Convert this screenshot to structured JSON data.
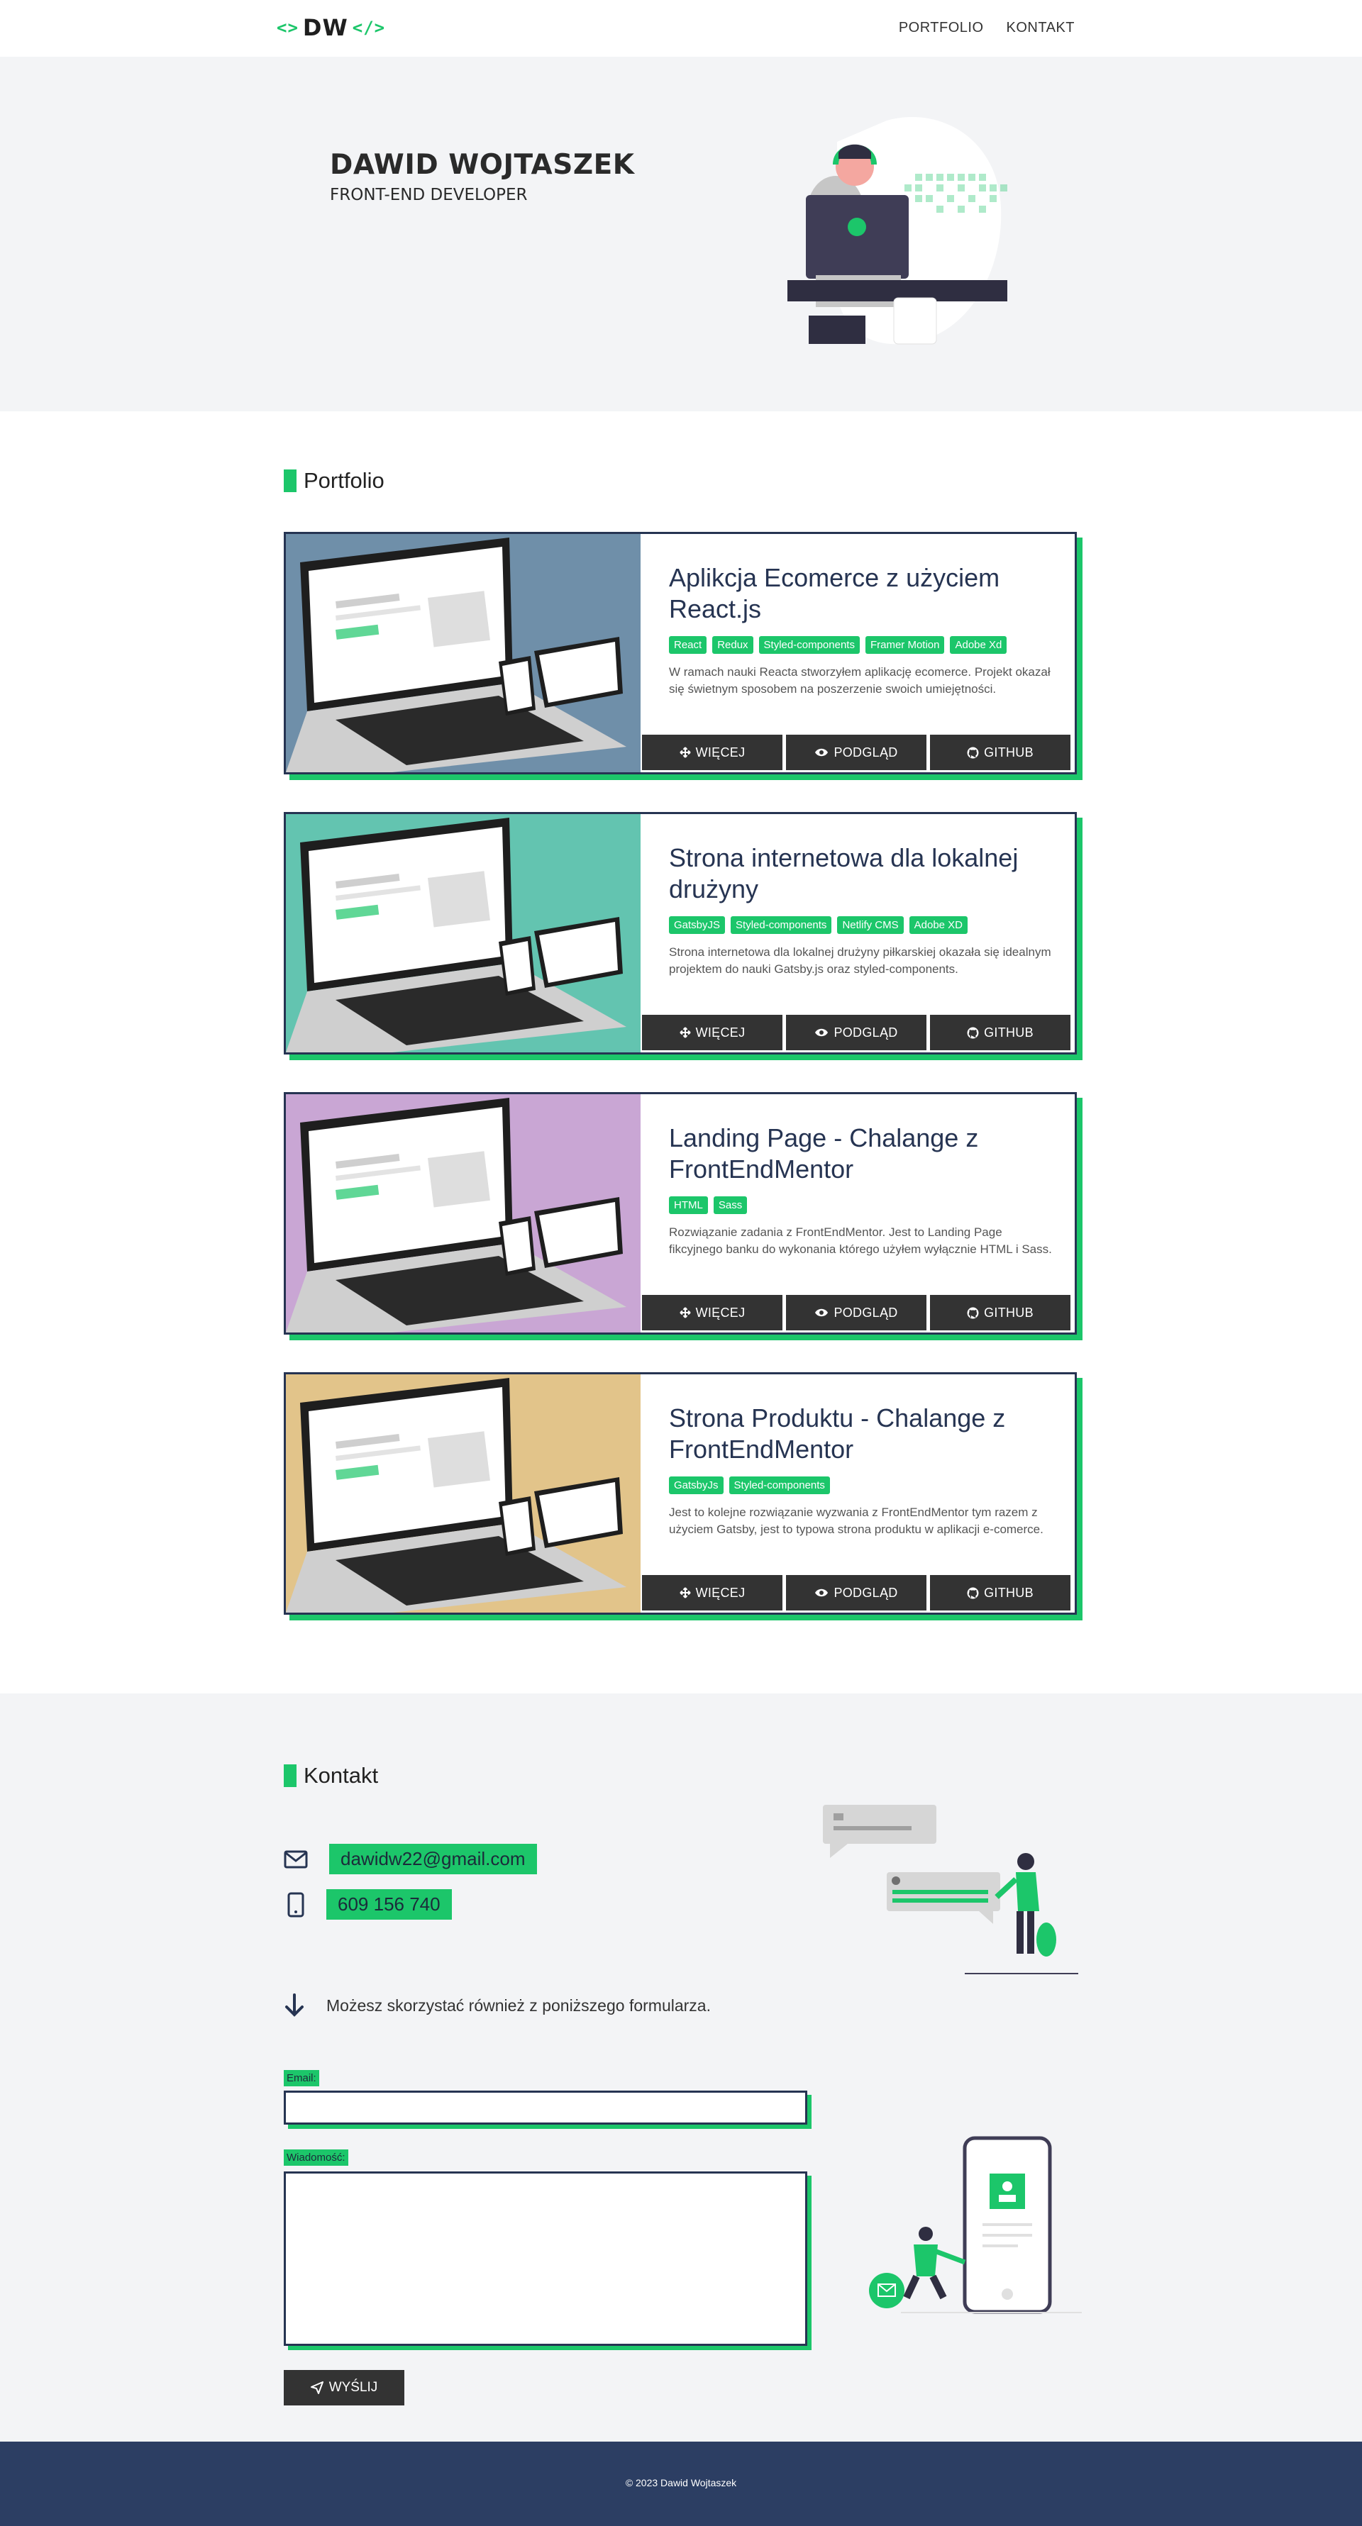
{
  "header": {
    "logo_text": "DW",
    "logo_left": "<>",
    "logo_right": "</>",
    "nav": [
      "PORTFOLIO",
      "KONTAKT"
    ]
  },
  "hero": {
    "name": "DAWID WOJTASZEK",
    "role": "FRONT-END DEVELOPER"
  },
  "portfolio": {
    "title": "Portfolio",
    "projects": [
      {
        "title": "Aplikcja Ecomerce z użyciem React.js",
        "tags": [
          "React",
          "Redux",
          "Styled-components",
          "Framer Motion",
          "Adobe Xd"
        ],
        "description": "W ramach nauki Reacta stworzyłem aplikację ecomerce. Projekt okazał się świetnym sposobem na poszerzenie swoich umiejętności.",
        "bg": "#6f8fa9"
      },
      {
        "title": "Strona internetowa dla lokalnej drużyny",
        "tags": [
          "GatsbyJS",
          "Styled-components",
          "Netlify CMS",
          "Adobe XD"
        ],
        "description": "Strona internetowa dla lokalnej drużyny piłkarskiej okazała się idealnym projektem do nauki Gatsby.js oraz styled-components.",
        "bg": "#63c4b0"
      },
      {
        "title": "Landing Page - Chalange z FrontEndMentor",
        "tags": [
          "HTML",
          "Sass"
        ],
        "description": "Rozwiązanie zadania z FrontEndMentor. Jest to Landing Page fikcyjnego banku do wykonania którego użyłem wyłącznie HTML i Sass.",
        "bg": "#c9a6d4"
      },
      {
        "title": "Strona Produktu - Chalange z FrontEndMentor",
        "tags": [
          "GatsbyJs",
          "Styled-components"
        ],
        "description": "Jest to kolejne rozwiązanie wyzwania z FrontEndMentor tym razem z użyciem Gatsby, jest to typowa strona produktu w aplikacji e-comerce.",
        "bg": "#e2c48a"
      }
    ],
    "buttons": [
      "WIĘCEJ",
      "PODGLĄD",
      "GITHUB"
    ]
  },
  "contact": {
    "title": "Kontakt",
    "email": "dawidw22@gmail.com",
    "phone": "609 156 740",
    "note": "Możesz skorzystać również z poniższego formularza.",
    "email_label": "Email:",
    "message_label": "Wiadomość:",
    "send_label": "WYŚLIJ"
  },
  "footer": {
    "copyright": "© 2023 Dawid Wojtaszek"
  },
  "colors": {
    "accent": "#1cc66a",
    "navy": "#263452",
    "footer": "#2c3e63",
    "button": "#333333"
  }
}
